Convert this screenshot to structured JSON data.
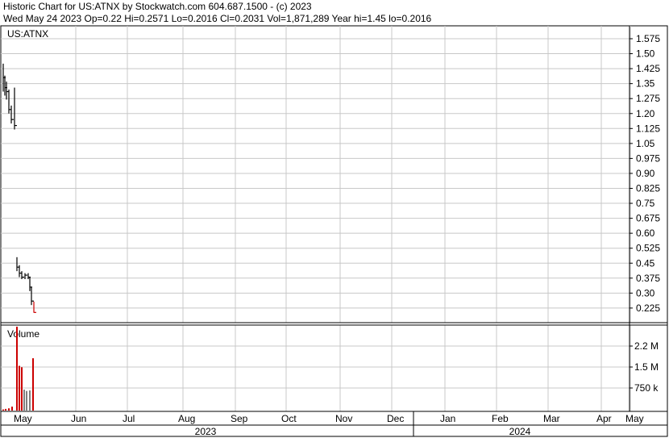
{
  "header": {
    "title": "Historic Chart for US:ATNX by Stockwatch.com 604.687.1500 - (c) 2023",
    "quote": "Wed May 24 2023   Op=0.22   Hi=0.2571   Lo=0.2016   Cl=0.2031   Vol=1,871,289   Year hi=1.45   lo=0.2016"
  },
  "chart_data": [
    {
      "type": "ohlc",
      "title": "US:ATNX",
      "y_ticks": [
        "1.575",
        "1.50",
        "1.425",
        "1.35",
        "1.275",
        "1.20",
        "1.125",
        "1.05",
        "0.975",
        "0.90",
        "0.825",
        "0.75",
        "0.675",
        "0.60",
        "0.525",
        "0.45",
        "0.375",
        "0.30",
        "0.225"
      ],
      "ylim": [
        0.17,
        1.62
      ],
      "x_labels": [
        "May",
        "Jun",
        "Jul",
        "Aug",
        "Sep",
        "Oct",
        "Nov",
        "Dec",
        "Jan",
        "Feb",
        "Mar",
        "Apr",
        "May"
      ],
      "year_labels": [
        "2023",
        "2024"
      ],
      "bars": [
        {
          "high": 1.45,
          "low": 1.31,
          "close": 1.38,
          "color": "#000000"
        },
        {
          "high": 1.39,
          "low": 1.29,
          "close": 1.33,
          "color": "#000000"
        },
        {
          "high": 1.36,
          "low": 1.27,
          "close": 1.31,
          "color": "#000000"
        },
        {
          "high": 1.32,
          "low": 1.2,
          "close": 1.22,
          "color": "#000000"
        },
        {
          "high": 1.24,
          "low": 1.15,
          "close": 1.17,
          "color": "#000000"
        },
        {
          "high": 1.33,
          "low": 1.12,
          "close": 1.14,
          "color": "#000000"
        },
        {
          "high": 0.48,
          "low": 0.41,
          "close": 0.43,
          "color": "#000000"
        },
        {
          "high": 0.44,
          "low": 0.38,
          "close": 0.4,
          "color": "#000000"
        },
        {
          "high": 0.41,
          "low": 0.37,
          "close": 0.38,
          "color": "#000000"
        },
        {
          "high": 0.4,
          "low": 0.37,
          "close": 0.39,
          "color": "#000000"
        },
        {
          "high": 0.4,
          "low": 0.37,
          "close": 0.38,
          "color": "#000000"
        },
        {
          "high": 0.38,
          "low": 0.31,
          "close": 0.33,
          "color": "#000000"
        },
        {
          "high": 0.33,
          "low": 0.24,
          "close": 0.26,
          "color": "#000000"
        },
        {
          "high": 0.2571,
          "low": 0.2016,
          "close": 0.2031,
          "color": "#cc0000"
        }
      ]
    },
    {
      "type": "bar",
      "title": "Volume",
      "y_ticks": [
        "2.2 M",
        "1.5 M",
        "750 k"
      ],
      "ylim": [
        0,
        3000000
      ],
      "values": [
        40000,
        60000,
        80000,
        140000,
        3000000,
        1600000,
        1550000,
        750000,
        700000,
        720000,
        1871289
      ],
      "colors": [
        "#cc0000",
        "#cc0000",
        "#cc0000",
        "#cc0000",
        "#cc0000",
        "#cc0000",
        "#cc0000",
        "#808080",
        "#808080",
        "#808080",
        "#cc0000"
      ]
    }
  ]
}
